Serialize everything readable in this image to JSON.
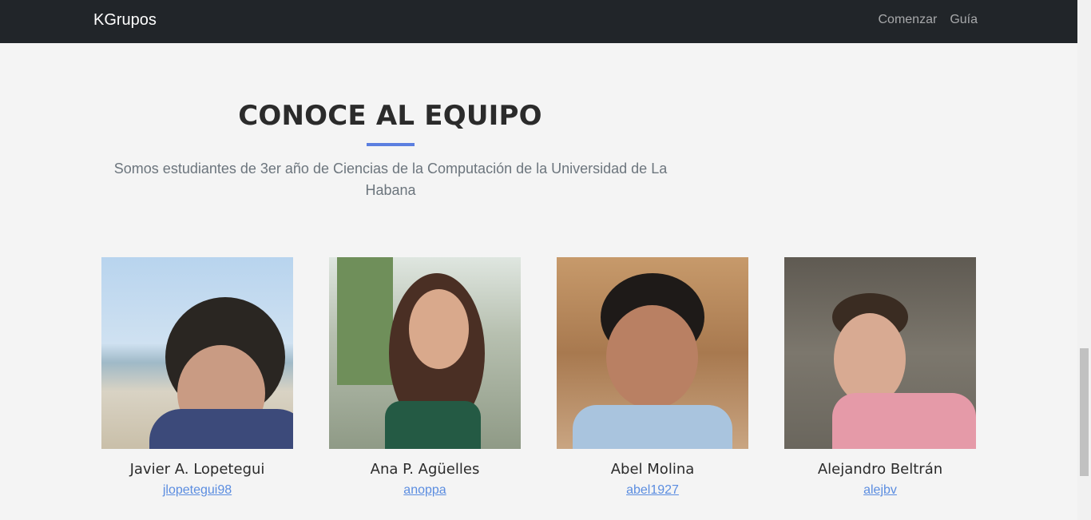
{
  "navbar": {
    "brand": "KGrupos",
    "links": [
      "Comenzar",
      "Guía"
    ]
  },
  "section": {
    "title": "CONOCE AL EQUIPO",
    "subtitle": "Somos estudiantes de 3er año de Ciencias de la Computación de la Universidad de La Habana"
  },
  "team": [
    {
      "name": "Javier A. Lopetegui",
      "username": "jlopetegui98"
    },
    {
      "name": "Ana P. Agüelles",
      "username": "anoppa"
    },
    {
      "name": "Abel Molina",
      "username": "abel1927"
    },
    {
      "name": "Alejandro Beltrán",
      "username": "alejbv"
    }
  ],
  "colors": {
    "navbar_bg": "#212529",
    "page_bg": "#f4f4f4",
    "accent": "#5b7fe0",
    "link": "#5b8de0"
  }
}
